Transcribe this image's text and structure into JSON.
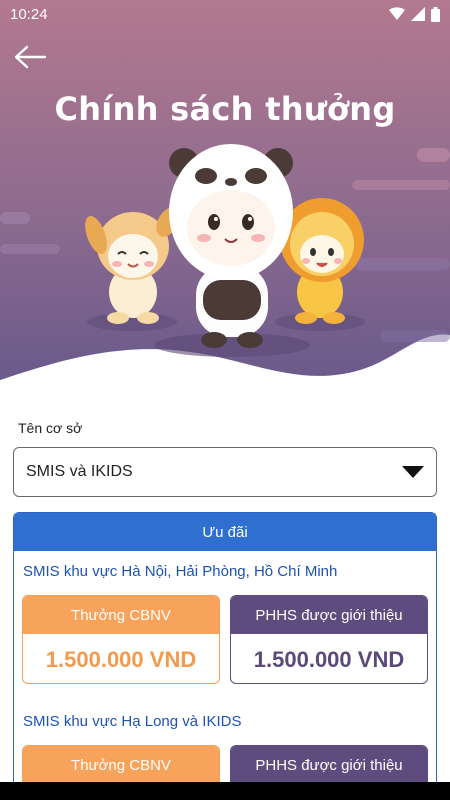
{
  "status_bar": {
    "time": "10:24"
  },
  "header": {
    "title": "Chính sách thưởng"
  },
  "facility": {
    "label": "Tên cơ sở",
    "selected": "SMIS và IKIDS"
  },
  "offers": {
    "title": "Ưu đãi",
    "groups": [
      {
        "region": "SMIS khu vực Hà Nội, Hải Phòng, Hồ Chí Minh",
        "staff_label": "Thưởng CBNV",
        "staff_amount": "1.500.000 VND",
        "parent_label": "PHHS được giới thiệu",
        "parent_amount": "1.500.000 VND"
      },
      {
        "region": "SMIS khu vực Hạ Long và IKIDS",
        "staff_label": "Thưởng CBNV",
        "parent_label": "PHHS được giới thiệu"
      }
    ]
  },
  "colors": {
    "header_top": "#b07a93",
    "header_bottom": "#6c5b8c",
    "accent_blue": "#2f6fcf",
    "orange": "#f7a35c",
    "purple": "#5f4c7f"
  }
}
